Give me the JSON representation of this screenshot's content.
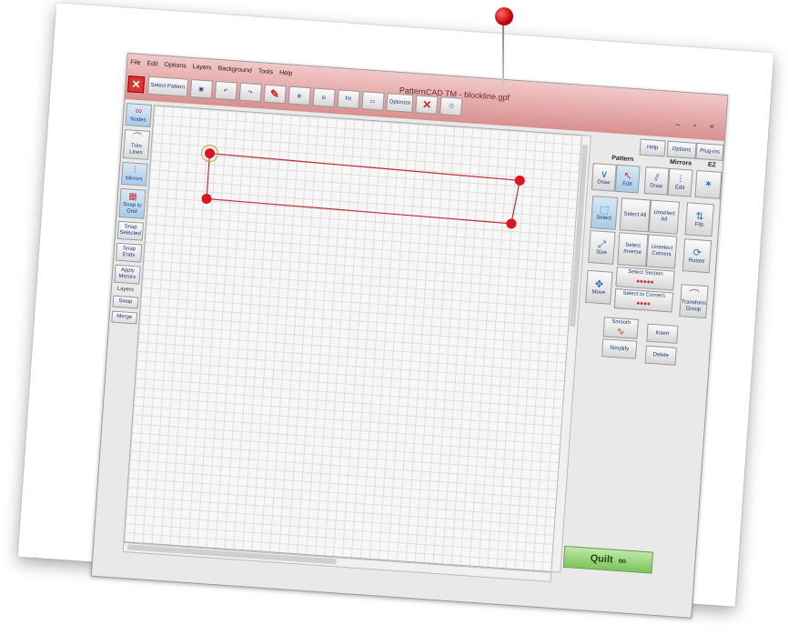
{
  "app": {
    "title": "PatternCAD TM - blockline.gpf",
    "window_controls": "– ▫ ×"
  },
  "menu": [
    "File",
    "Edit",
    "Options",
    "Layers",
    "Background",
    "Tools",
    "Help"
  ],
  "toolbar": {
    "select_pattern": "Select Pattern",
    "fit": "Fit",
    "optimize": "Optimize"
  },
  "left_tools": {
    "nodes": "Nodes",
    "trim_lines": "Trim Lines",
    "mirrors": "Mirrors",
    "snap_to_grid": "Snap to Grid",
    "snap_selected": "Snap Selected",
    "snap_ends": "Snap Ends",
    "apply_mirrors": "Apply Mirrors",
    "layers_header": "Layers",
    "swap": "Swap",
    "merge": "Merge"
  },
  "right_panel": {
    "help": "Help",
    "options": "Options",
    "plugins": "Plug-ins",
    "pattern_header": "Pattern",
    "mirrors_header": "Mirrors",
    "ez_header": "EZ",
    "pattern_draw": "Draw",
    "pattern_edit": "Edit",
    "mirrors_draw": "Draw",
    "mirrors_edit": "Edit",
    "select": "Select",
    "select_all": "Select All",
    "unselect_all": "Unselect All",
    "flip": "Flip",
    "size": "Size",
    "select_inverse": "Select Inverse",
    "unselect_corners": "Unselect Corners",
    "rotate": "Rotate",
    "select_section": "Select Section",
    "move": "Move",
    "select_to_corners": "Select to Corners",
    "transform_group": "Transform Group",
    "smooth": "Smooth",
    "insert": "Insert",
    "simplify": "Simplify",
    "delete": "Delete",
    "quilt": "Quilt"
  },
  "colors": {
    "node": "#e0141e",
    "pattern_line": "#c0303a",
    "accent_red": "#d33333",
    "quilt_green": "#7cc35c",
    "titlebar_pink": "#e0a0a0"
  }
}
